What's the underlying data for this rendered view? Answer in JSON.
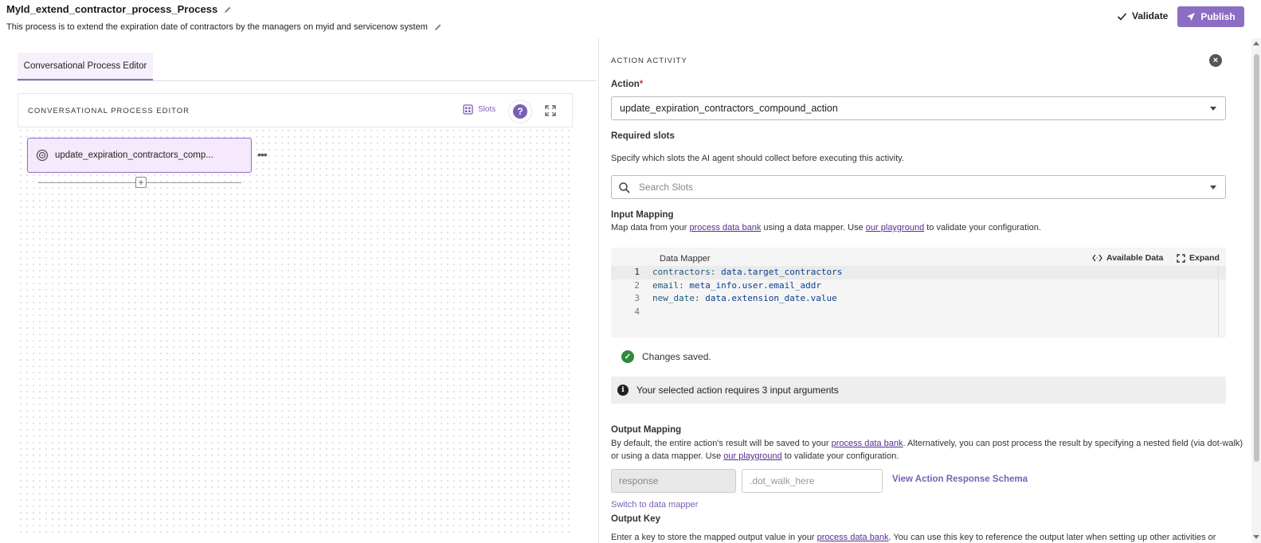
{
  "header": {
    "title": "MyId_extend_contractor_process_Process",
    "description": "This process is to extend the expiration date of contractors by the managers on myid and servicenow system",
    "validate_label": "Validate",
    "publish_label": "Publish"
  },
  "left": {
    "tab_label": "Conversational Process Editor",
    "editor_title": "CONVERSATIONAL PROCESS EDITOR",
    "slots_label": "Slots",
    "help_glyph": "?",
    "node_label": "update_expiration_contractors_comp...",
    "node_menu": "•••",
    "add_glyph": "+"
  },
  "right": {
    "section_title": "ACTION ACTIVITY",
    "action_label": "Action",
    "action_required": "*",
    "action_value": "update_expiration_contractors_compound_action",
    "required_slots_label": "Required slots",
    "required_slots_help": "Specify which slots the AI agent should collect before executing this activity.",
    "search_placeholder": "Search Slots",
    "input_mapping": {
      "label": "Input Mapping",
      "help_pre": "Map data from your ",
      "link1": "process data bank",
      "help_mid": " using a data mapper. Use ",
      "link2": "our playground",
      "help_post": " to validate your configuration."
    },
    "mapper": {
      "title": "Data Mapper",
      "available_label": "Available Data",
      "expand_label": "Expand",
      "lines": [
        {
          "num": "1",
          "key": "contractors:",
          "value": " data.target_contractors"
        },
        {
          "num": "2",
          "key": "email:",
          "value": " meta_info.user.email_addr"
        },
        {
          "num": "3",
          "key": "new_date:",
          "value": " data.extension_date.value"
        },
        {
          "num": "4",
          "key": "",
          "value": ""
        }
      ]
    },
    "saved_text": "Changes saved.",
    "info_text": "Your selected action requires 3 input arguments",
    "output_mapping": {
      "label": "Output Mapping",
      "line1_pre": "By default, the entire action's result will be saved to your ",
      "line1_link": "process data bank",
      "line1_post": ". Alternatively, you can post process the result by specifying a nested field (via dot-walk)",
      "line2_pre": "or using a data mapper. Use ",
      "line2_link": "our playground",
      "line2_post": " to validate your configuration.",
      "response_value": "response",
      "dotwalk_placeholder": ".dot_walk_here",
      "view_schema_label": "View Action Response Schema",
      "switch_label": "Switch to data mapper"
    },
    "output_key": {
      "label": "Output Key",
      "help_pre": "Enter a key to store the mapped output value in your ",
      "help_link": "process data bank",
      "help_post": ". You can use this key to reference the output later when setting up other activities or"
    }
  },
  "colors": {
    "accent": "#8b6dc3",
    "link": "#5a2c91",
    "success": "#2e8b3d"
  }
}
